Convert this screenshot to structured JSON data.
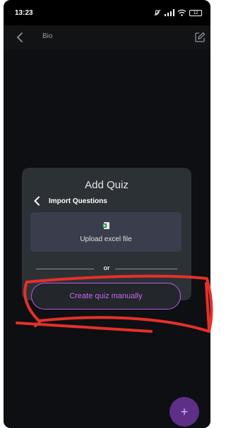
{
  "status_bar": {
    "time": "13:23",
    "battery": "12"
  },
  "top_bar": {
    "title": "Bio"
  },
  "dialog": {
    "title": "Add Quiz",
    "import_label": "Import Questions",
    "upload_label": "Upload excel file",
    "divider_text": "or",
    "create_button_label": "Create quiz manually"
  },
  "fab": {
    "label": "+"
  },
  "colors": {
    "accent": "#b85ae6",
    "dialog_bg": "#2c3136",
    "upload_bg": "#3a3d4b",
    "annotation": "#e5302a",
    "fab_bg": "#5d2f87"
  },
  "icons": {
    "back": "chevron-left-icon",
    "edit": "edit-square-icon",
    "excel": "excel-file-icon",
    "add": "plus-icon"
  }
}
